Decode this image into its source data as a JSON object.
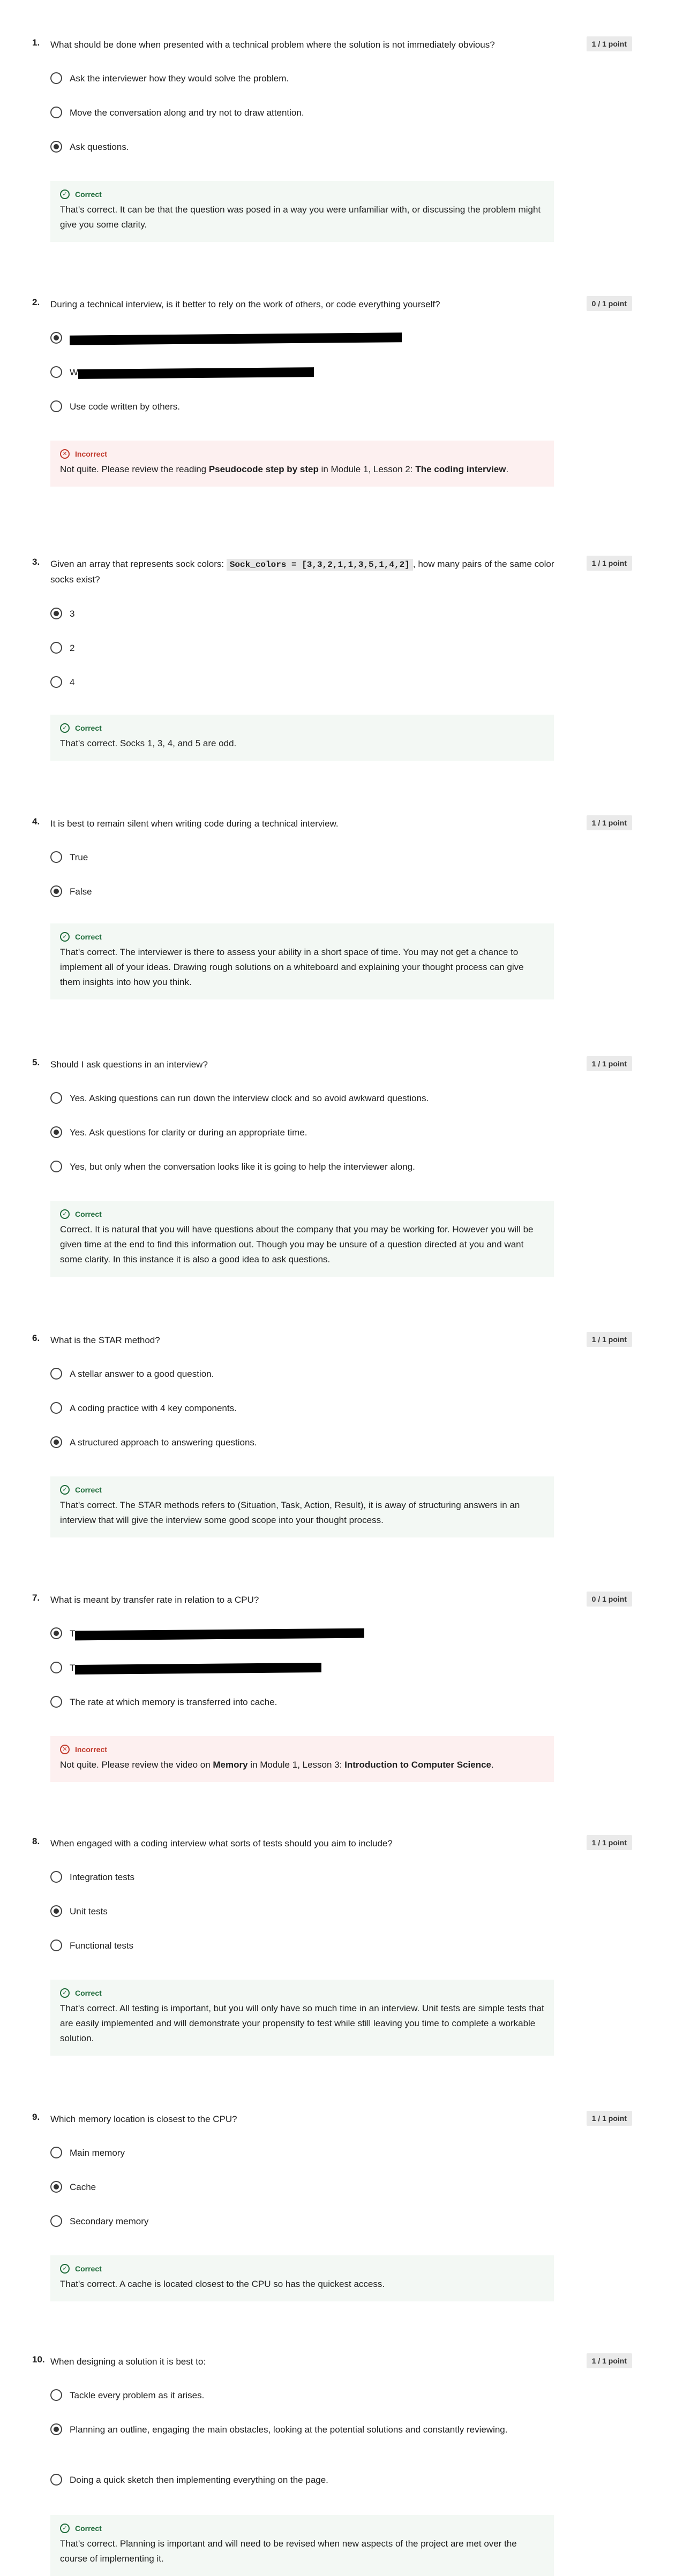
{
  "questions": [
    {
      "num": "1.",
      "text": "What should be done when presented with a technical problem where the solution is not immediately obvious?",
      "points": "1 / 1 point",
      "options": [
        {
          "label": "Ask the interviewer how they would solve the problem.",
          "checked": false,
          "redacted": false
        },
        {
          "label": "Move the conversation along and try not to draw attention.",
          "checked": false,
          "redacted": false
        },
        {
          "label": "Ask questions.",
          "checked": true,
          "redacted": false
        }
      ],
      "feedback": {
        "status": "correct",
        "heading": "Correct",
        "text": "That's correct. It can be that the question was posed in a way you were unfamiliar with, or discussing the problem might give you some clarity."
      }
    },
    {
      "num": "2.",
      "text": "During a technical interview, is it better to rely on the work of others, or code everything yourself?",
      "points": "0 / 1 point",
      "options": [
        {
          "label": "",
          "checked": true,
          "redacted": true
        },
        {
          "label": "W",
          "checked": false,
          "redacted": true
        },
        {
          "label": "Use code written by others.",
          "checked": false,
          "redacted": false
        }
      ],
      "feedback": {
        "status": "incorrect",
        "heading": "Incorrect",
        "text_before": "Not quite. Please review the reading ",
        "bold1": "Pseudocode step by step",
        "text_mid": " in Module 1, Lesson 2: ",
        "bold2": "The coding interview",
        "text_after": "."
      }
    },
    {
      "num": "3.",
      "text_before": "Given an array that represents sock colors: ",
      "code": "Sock_colors = [3,3,2,1,1,3,5,1,4,2]",
      "text_after": ", how many pairs of the same color socks exist?",
      "points": "1 / 1 point",
      "options": [
        {
          "label": "3",
          "checked": true,
          "redacted": false
        },
        {
          "label": "2",
          "checked": false,
          "redacted": false
        },
        {
          "label": "4",
          "checked": false,
          "redacted": false
        }
      ],
      "feedback": {
        "status": "correct",
        "heading": "Correct",
        "text": "That's correct. Socks 1, 3, 4, and 5 are odd."
      }
    },
    {
      "num": "4.",
      "text": "It is best to remain silent when writing code during a technical interview.",
      "points": "1 / 1 point",
      "options": [
        {
          "label": "True",
          "checked": false,
          "redacted": false
        },
        {
          "label": "False",
          "checked": true,
          "redacted": false
        }
      ],
      "feedback": {
        "status": "correct",
        "heading": "Correct",
        "text": "That's correct. The interviewer is there to assess your ability in a short space of time. You may not get a chance to implement all of your ideas. Drawing rough solutions on a whiteboard and explaining your thought process can give them insights into how you think."
      }
    },
    {
      "num": "5.",
      "text": "Should I ask questions in an interview?",
      "points": "1 / 1 point",
      "options": [
        {
          "label": "Yes. Asking questions can run down the interview clock and so avoid awkward questions.",
          "checked": false,
          "redacted": false
        },
        {
          "label": "Yes. Ask questions for clarity or during an appropriate time.",
          "checked": true,
          "redacted": false
        },
        {
          "label": "Yes, but only when the conversation looks like it is going to help the interviewer along.",
          "checked": false,
          "redacted": false
        }
      ],
      "feedback": {
        "status": "correct",
        "heading": "Correct",
        "text": "Correct. It is natural that you will have questions about the company that you may be working for. However you will be given time at the end to find this information out. Though you may be unsure of a question directed at you and want some clarity. In this instance it is also a good idea to ask questions."
      }
    },
    {
      "num": "6.",
      "text": "What is the STAR method?",
      "points": "1 / 1 point",
      "options": [
        {
          "label": "A stellar answer to a good question.",
          "checked": false,
          "redacted": false
        },
        {
          "label": "A coding practice with 4 key components.",
          "checked": false,
          "redacted": false
        },
        {
          "label": "A structured approach to answering questions.",
          "checked": true,
          "redacted": false
        }
      ],
      "feedback": {
        "status": "correct",
        "heading": "Correct",
        "text": "That's correct. The STAR methods refers to (Situation, Task, Action, Result), it is away of structuring answers in an interview that will give the interview some good scope into your thought process."
      }
    },
    {
      "num": "7.",
      "text": "What is meant by transfer rate in relation to a CPU?",
      "points": "0 / 1 point",
      "options": [
        {
          "label": "T",
          "checked": true,
          "redacted": true
        },
        {
          "label": "T",
          "checked": false,
          "redacted": true
        },
        {
          "label": "The rate at which memory is transferred into cache.",
          "checked": false,
          "redacted": false
        }
      ],
      "feedback": {
        "status": "incorrect",
        "heading": "Incorrect",
        "text_before": "Not quite. Please review the video on ",
        "bold1": "Memory",
        "text_mid": " in Module 1, Lesson 3: ",
        "bold2": "Introduction to Computer Science",
        "text_after": "."
      }
    },
    {
      "num": "8.",
      "text": "When engaged with a coding interview what sorts of tests should you aim to include?",
      "points": "1 / 1 point",
      "options": [
        {
          "label": "Integration tests",
          "checked": false,
          "redacted": false
        },
        {
          "label": "Unit tests",
          "checked": true,
          "redacted": false
        },
        {
          "label": "Functional tests",
          "checked": false,
          "redacted": false
        }
      ],
      "feedback": {
        "status": "correct",
        "heading": "Correct",
        "text": "That's correct. All testing is important, but you will only have so much time in an interview. Unit tests are simple tests that are easily implemented and will demonstrate your propensity to test while still leaving you time to complete a workable solution."
      }
    },
    {
      "num": "9.",
      "text": "Which memory location is closest to the CPU?",
      "points": "1 / 1 point",
      "options": [
        {
          "label": "Main memory",
          "checked": false,
          "redacted": false
        },
        {
          "label": "Cache",
          "checked": true,
          "redacted": false
        },
        {
          "label": "Secondary memory",
          "checked": false,
          "redacted": false
        }
      ],
      "feedback": {
        "status": "correct",
        "heading": "Correct",
        "text": "That's correct. A cache is located closest to the CPU so has the quickest access."
      }
    },
    {
      "num": "10.",
      "text": "When designing a solution it is best to:",
      "points": "1 / 1 point",
      "options": [
        {
          "label": "Tackle every problem as it arises.",
          "checked": false,
          "redacted": false
        },
        {
          "label": "Planning an outline, engaging the main obstacles, looking at the potential solutions and constantly reviewing.",
          "checked": true,
          "redacted": false
        },
        {
          "label": "Doing a quick sketch then implementing everything on the page.",
          "checked": false,
          "redacted": false
        }
      ],
      "feedback": {
        "status": "correct",
        "heading": "Correct",
        "text": "That's correct. Planning is important and will need to be revised when new aspects of the project are met over the course of implementing it."
      }
    }
  ]
}
